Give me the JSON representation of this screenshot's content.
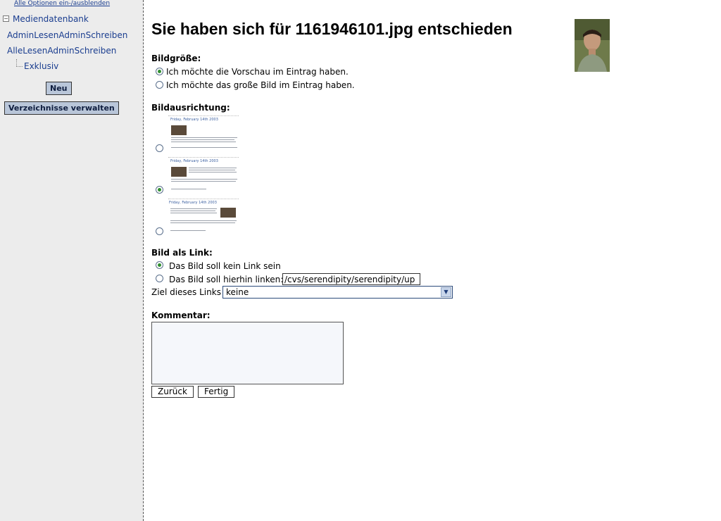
{
  "sidebar": {
    "toggle_all": "Alle Optionen ein-/ausblenden",
    "tree_root": "Mediendatenbank",
    "items": [
      {
        "label": "AdminLesenAdminSchreiben"
      },
      {
        "label": "AlleLesenAdminSchreiben"
      },
      {
        "label": "Exklusiv"
      }
    ],
    "new_button": "Neu",
    "manage_button": "Verzeichnisse verwalten"
  },
  "main": {
    "title": "Sie haben sich für 1161946101.jpg entschieden",
    "image_size": {
      "label": "Bildgröße:",
      "options": [
        {
          "label": "Ich möchte die Vorschau im Eintrag haben.",
          "checked": true
        },
        {
          "label": "Ich möchte das große Bild im Eintrag haben.",
          "checked": false
        }
      ]
    },
    "alignment": {
      "label": "Bildausrichtung:",
      "preview_date": "Friday, February 14th 2003",
      "options": [
        {
          "position": "none",
          "checked": false
        },
        {
          "position": "left",
          "checked": true
        },
        {
          "position": "right",
          "checked": false
        }
      ]
    },
    "link": {
      "label": "Bild als Link:",
      "no_link_label": "Das Bild soll kein Link sein",
      "link_to_label": "Das Bild soll hierhin linken:",
      "no_link_checked": true,
      "link_value": "/cvs/serendipity/serendipity/up",
      "target_label": "Ziel dieses Links",
      "target_selected": "keine"
    },
    "comment": {
      "label": "Kommentar:",
      "value": ""
    },
    "buttons": {
      "back": "Zurück",
      "done": "Fertig"
    }
  },
  "colors": {
    "sidebar_bg": "#ececec",
    "link": "#1a3d8f",
    "button_bg": "#b9c6d9",
    "radio_checked": "#2f8e2f"
  }
}
